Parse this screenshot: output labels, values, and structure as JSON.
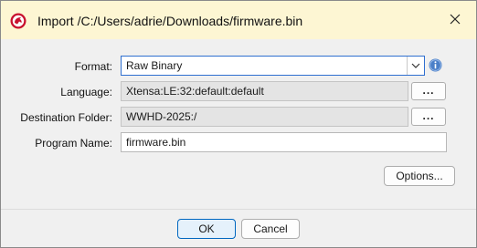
{
  "dialog": {
    "title": "Import /C:/Users/adrie/Downloads/firmware.bin"
  },
  "form": {
    "format_label": "Format:",
    "format_value": "Raw Binary",
    "language_label": "Language:",
    "language_value": "Xtensa:LE:32:default:default",
    "destination_label": "Destination Folder:",
    "destination_value": "WWHD-2025:/",
    "program_name_label": "Program Name:",
    "program_name_value": "firmware.bin",
    "browse_label": "...",
    "options_label": "Options..."
  },
  "buttons": {
    "ok_label": "OK",
    "cancel_label": "Cancel"
  },
  "icons": {
    "title": "app-dragon-icon",
    "close": "close-icon",
    "dropdown": "chevron-down-icon",
    "info": "info-icon"
  },
  "colors": {
    "titlebar": "#fdf6d3",
    "accent": "#0067c0",
    "info_icon": "#4a7fc8",
    "app_icon": "#c8102e"
  }
}
